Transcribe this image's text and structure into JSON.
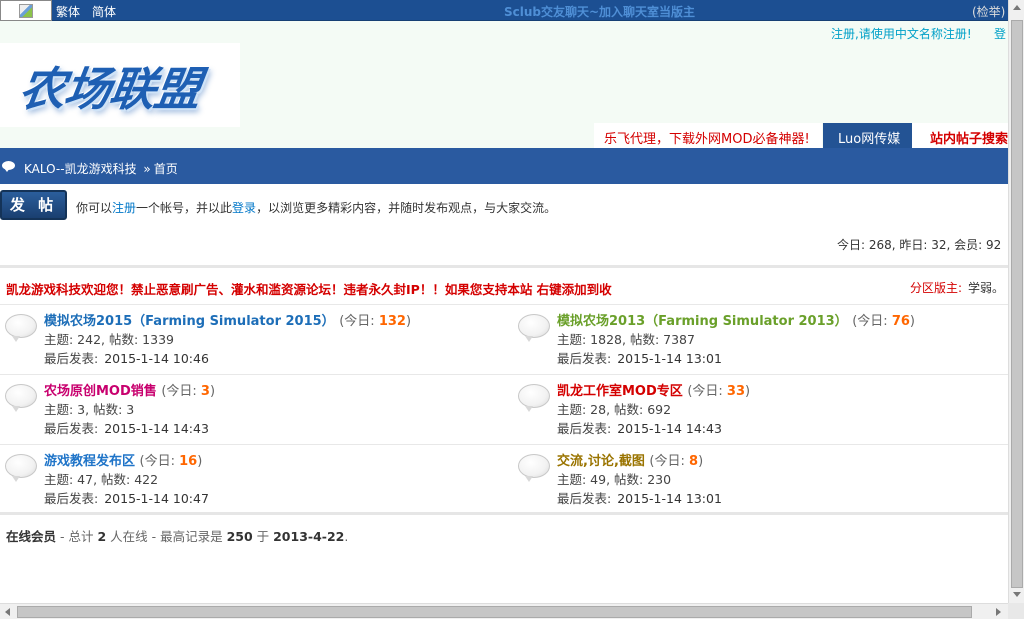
{
  "topbar": {
    "lang_traditional": "繁体",
    "lang_simplified": "简体",
    "marquee": "Sclub交友聊天~加入聊天室当版主",
    "report": "(检举)"
  },
  "header": {
    "register_note": "注册,请使用中文名称注册!",
    "login_link": "登",
    "logo_text": "农场联盟",
    "tabs": {
      "ad": "乐飞代理，下载外网MOD必备神器!",
      "active": "Luo网传媒",
      "search": "站内帖子搜索"
    }
  },
  "nav": {
    "site": "KALO--凯龙游戏科技",
    "separator": "»",
    "current": "首页"
  },
  "post": {
    "button": "发 帖",
    "note_prefix": "你可以",
    "register_link": "注册",
    "note_middle": "一个帐号，并以此",
    "login_link": "登录",
    "note_suffix": "，以浏览更多精彩内容，并随时发布观点，与大家交流。"
  },
  "stats": "今日: 268, 昨日: 32, 会员: 92",
  "group": {
    "announcement": "凯龙游戏科技欢迎您！禁止恶意刷广告、灌水和滥资源论坛！违者永久封IP！！如果您支持本站 右键添加到收",
    "moderator_label": "分区版主:",
    "moderator_name": "学弱。"
  },
  "forums": [
    {
      "title": "模拟农场2015（Farming Simulator 2015）",
      "today_label": "(今日:",
      "today": "132",
      "close": ")",
      "stats": "主题: 242, 帖数: 1339",
      "last_label": "最后发表:",
      "last_date": "2015-1-14 10:46",
      "color": "#1d6eb8"
    },
    {
      "title": "模拟农场2013（Farming Simulator 2013）",
      "today_label": "(今日:",
      "today": "76",
      "close": ")",
      "stats": "主题: 1828, 帖数: 7387",
      "last_label": "最后发表:",
      "last_date": "2015-1-14 13:01",
      "color": "#6aa02a"
    },
    {
      "title": "农场原创MOD销售",
      "today_label": "(今日:",
      "today": "3",
      "close": ")",
      "stats": "主题: 3, 帖数: 3",
      "last_label": "最后发表:",
      "last_date": "2015-1-14 14:43",
      "color": "#c8006e"
    },
    {
      "title": "凯龙工作室MOD专区",
      "today_label": "(今日:",
      "today": "33",
      "close": ")",
      "stats": "主题: 28, 帖数: 692",
      "last_label": "最后发表:",
      "last_date": "2015-1-14 14:43",
      "color": "#d40000"
    },
    {
      "title": "游戏教程发布区",
      "today_label": "(今日:",
      "today": "16",
      "close": ")",
      "stats": "主题: 47, 帖数: 422",
      "last_label": "最后发表:",
      "last_date": "2015-1-14 10:47",
      "color": "#1f74c8"
    },
    {
      "title": "交流,讨论,截图",
      "today_label": "(今日:",
      "today": "8",
      "close": ")",
      "stats": "主题: 49, 帖数: 230",
      "last_label": "最后发表:",
      "last_date": "2015-1-14 13:01",
      "color": "#9a7400"
    }
  ],
  "online": {
    "label": "在线会员",
    "text1": " - 总计 ",
    "count": "2",
    "text2": " 人在线 - 最高记录是 ",
    "record": "250",
    "text3": " 于 ",
    "record_date": "2013-4-22",
    "text4": "."
  }
}
